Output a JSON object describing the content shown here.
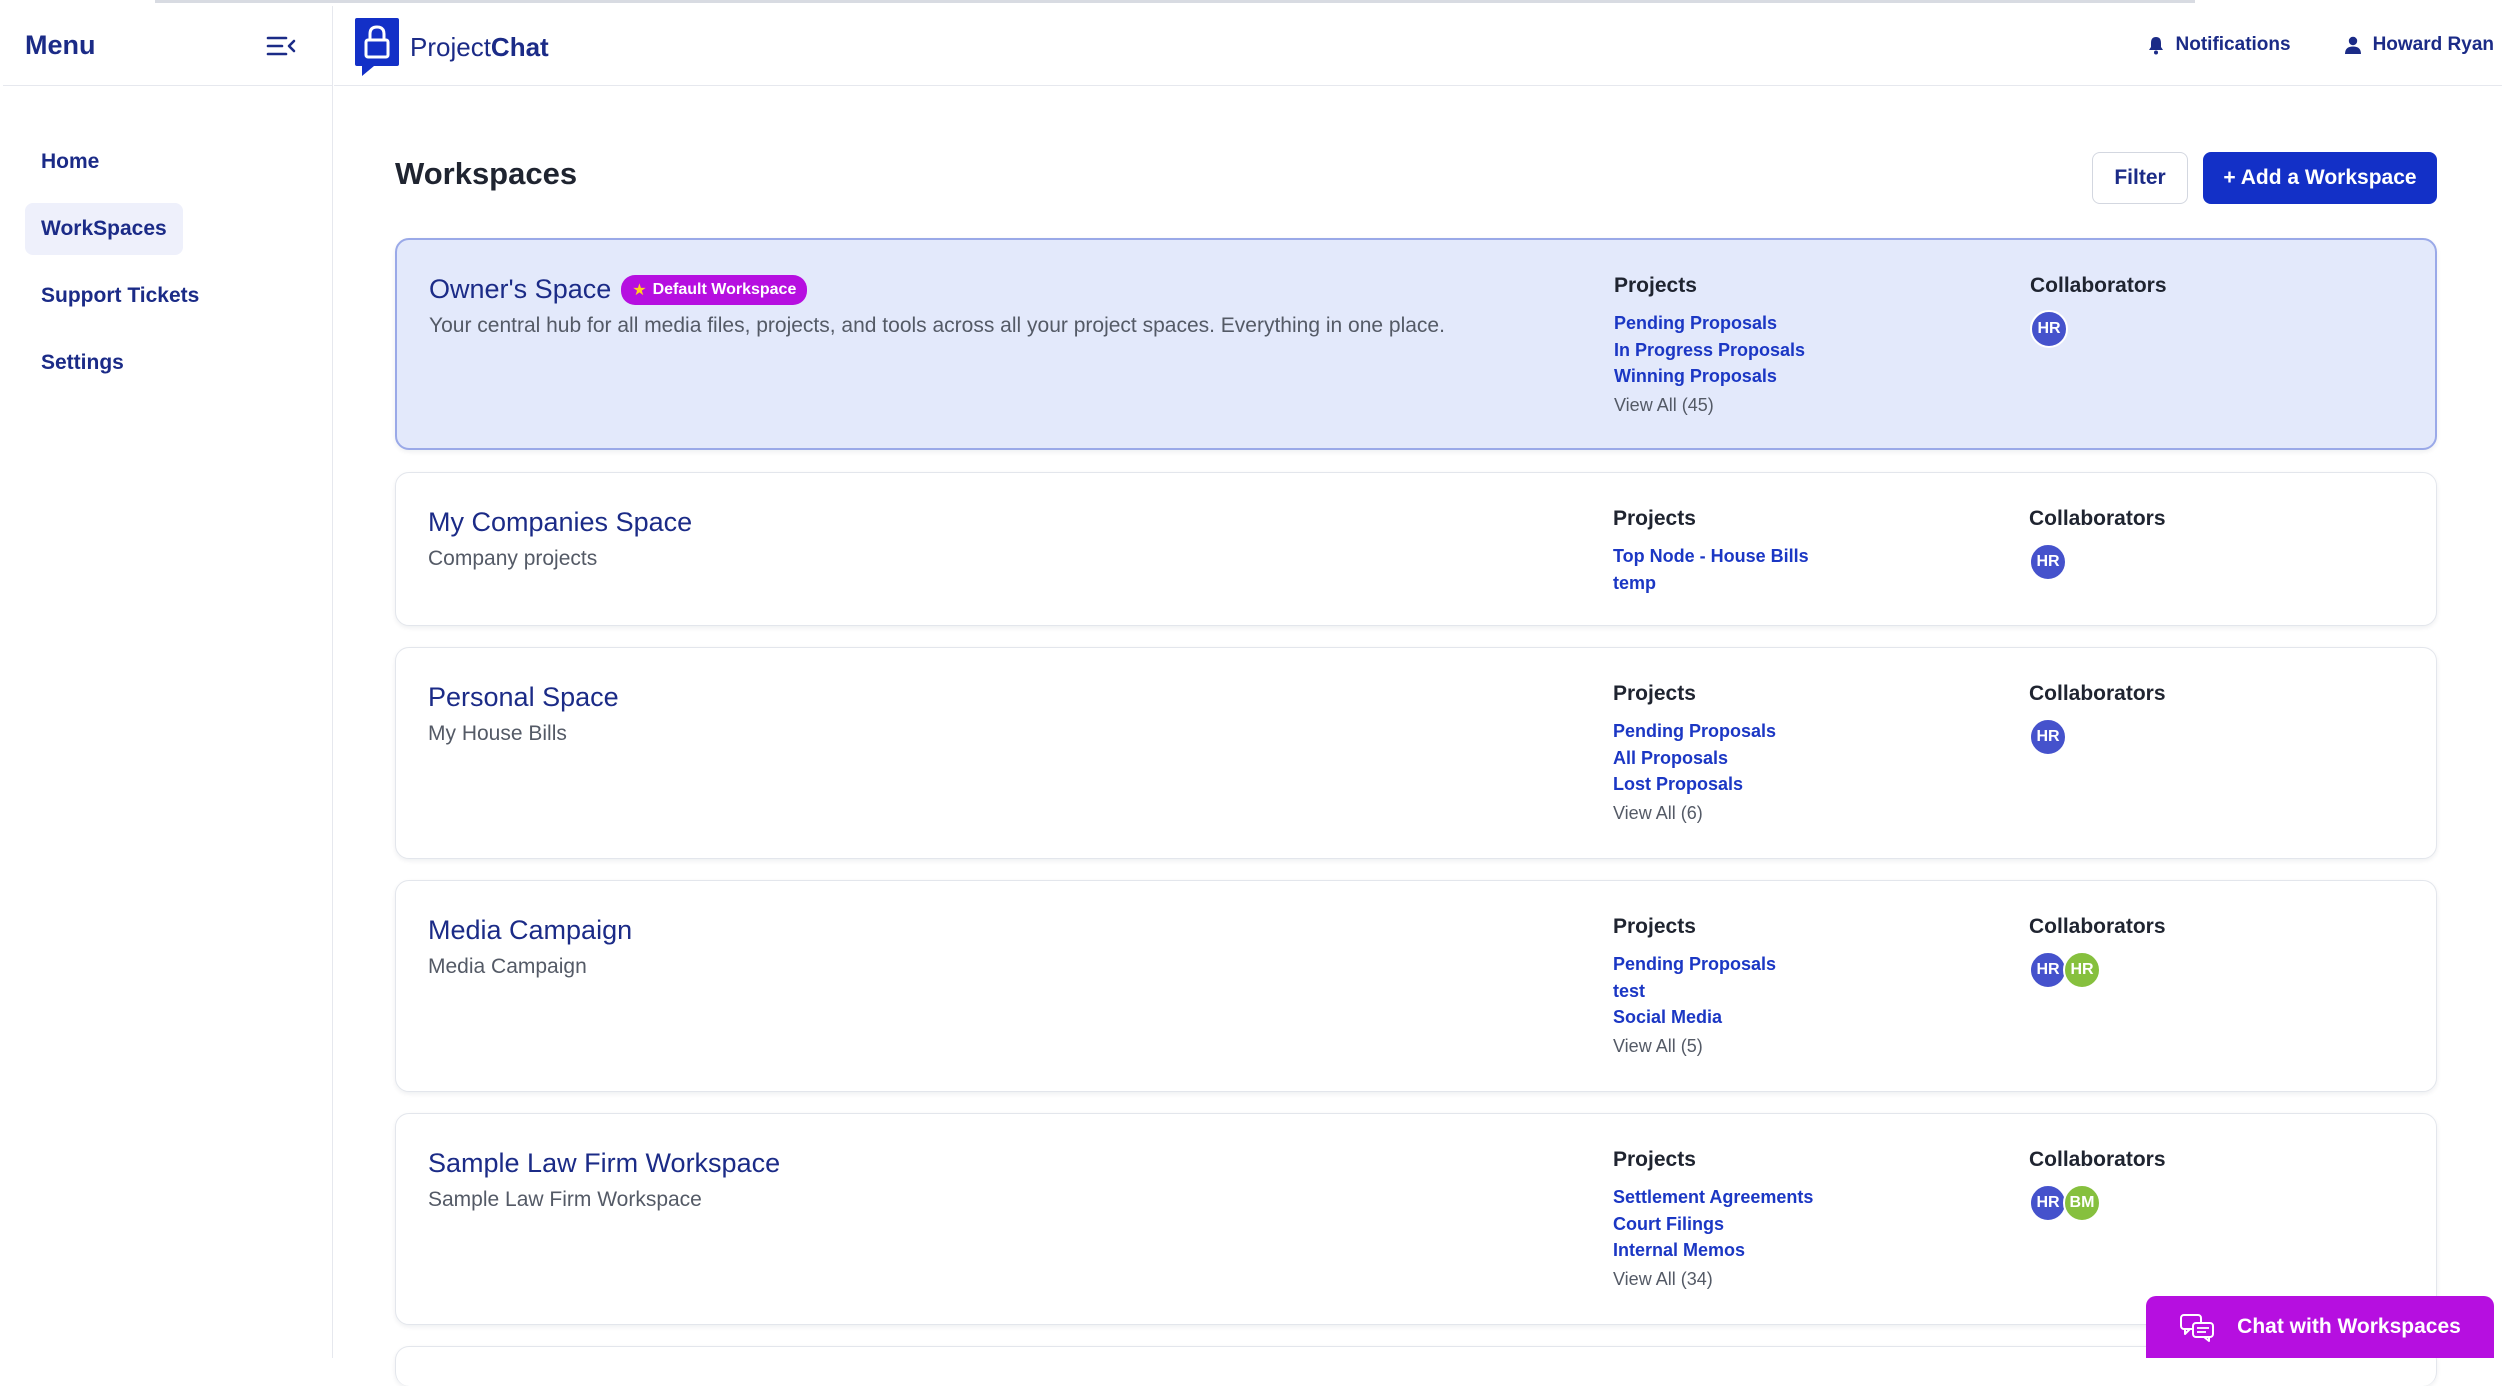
{
  "sidebar": {
    "title": "Menu",
    "collapse_icon": "collapse-menu-icon",
    "items": [
      {
        "label": "Home",
        "active": false
      },
      {
        "label": "WorkSpaces",
        "active": true
      },
      {
        "label": "Support Tickets",
        "active": false
      },
      {
        "label": "Settings",
        "active": false
      }
    ]
  },
  "header": {
    "logo_prefix": "Project",
    "logo_suffix": "Chat",
    "notifications_label": "Notifications",
    "user_name": "Howard Ryan"
  },
  "main": {
    "title": "Workspaces",
    "filter_label": "Filter",
    "add_label": "+ Add a Workspace"
  },
  "labels": {
    "projects": "Projects",
    "collaborators": "Collaborators"
  },
  "workspaces": [
    {
      "title": "Owner's Space",
      "badge": "Default Workspace",
      "description": "Your central hub for all media files, projects, and tools across all your project spaces. Everything in one place.",
      "projects": [
        "Pending Proposals",
        "In Progress Proposals",
        "Winning Proposals"
      ],
      "view_all": "View All (45)",
      "collaborators": [
        {
          "initials": "HR",
          "color": "#4552cc"
        }
      ]
    },
    {
      "title": "My Companies Space",
      "description": "Company projects",
      "projects": [
        "Top Node - House Bills",
        "temp"
      ],
      "collaborators": [
        {
          "initials": "HR",
          "color": "#4552cc"
        }
      ]
    },
    {
      "title": "Personal Space",
      "description": "My House Bills",
      "projects": [
        "Pending Proposals",
        "All Proposals",
        "Lost Proposals"
      ],
      "view_all": "View All (6)",
      "collaborators": [
        {
          "initials": "HR",
          "color": "#4552cc"
        }
      ]
    },
    {
      "title": "Media Campaign",
      "description": "Media Campaign",
      "projects": [
        "Pending Proposals",
        "test",
        "Social Media"
      ],
      "view_all": "View All (5)",
      "collaborators": [
        {
          "initials": "HR",
          "color": "#4552cc"
        },
        {
          "initials": "HR",
          "color": "#86c03e"
        }
      ]
    },
    {
      "title": "Sample Law Firm Workspace",
      "description": "Sample Law Firm Workspace",
      "projects": [
        "Settlement Agreements",
        "Court Filings",
        "Internal Memos"
      ],
      "view_all": "View All (34)",
      "collaborators": [
        {
          "initials": "HR",
          "color": "#4552cc"
        },
        {
          "initials": "BM",
          "color": "#86c03e"
        }
      ]
    }
  ],
  "chat_button": {
    "label": "Chat with Workspaces",
    "icon": "chat-bubbles-icon"
  }
}
